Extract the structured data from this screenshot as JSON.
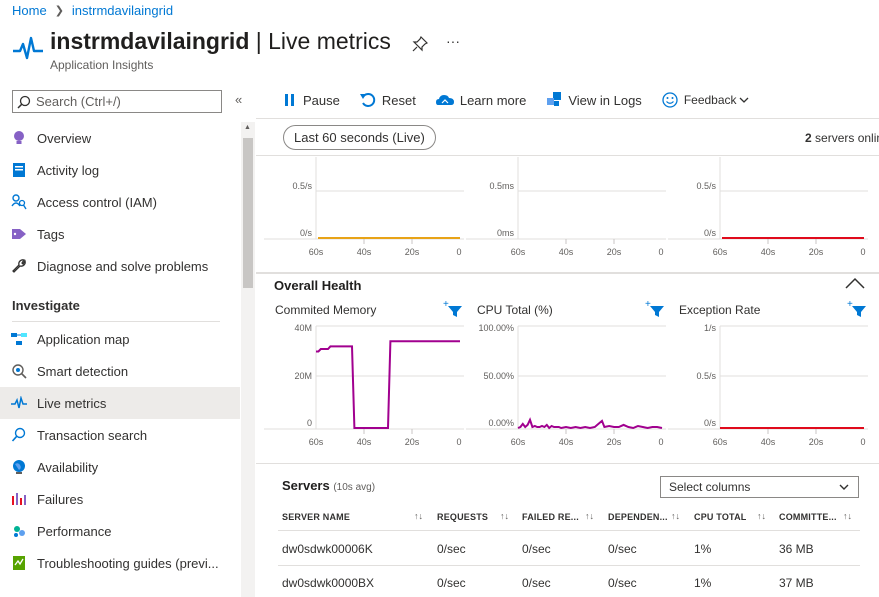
{
  "breadcrumb": {
    "home": "Home",
    "resource": "instrmdavilaingrid"
  },
  "header": {
    "resource_name": "instrmdavilaingrid",
    "separator": " | ",
    "page_name": "Live metrics",
    "subtitle": "Application Insights",
    "pin_icon": "pin-icon",
    "more_label": "···"
  },
  "sidebar": {
    "search_placeholder": "Search (Ctrl+/)",
    "collapse_label": "«",
    "section_investigate": "Investigate",
    "items": [
      {
        "label": "Overview",
        "icon": "lightbulb-icon",
        "color": "#8661c5"
      },
      {
        "label": "Activity log",
        "icon": "activity-log-icon",
        "color": "#0078d4"
      },
      {
        "label": "Access control (IAM)",
        "icon": "people-icon",
        "color": "#0078d4"
      },
      {
        "label": "Tags",
        "icon": "tag-icon",
        "color": "#8661c5"
      },
      {
        "label": "Diagnose and solve problems",
        "icon": "wrench-icon",
        "color": "#323130"
      },
      {
        "label": "Application map",
        "icon": "app-map-icon",
        "color": "#0078d4"
      },
      {
        "label": "Smart detection",
        "icon": "smart-detection-icon",
        "color": "#605e5c"
      },
      {
        "label": "Live metrics",
        "icon": "pulse-icon",
        "color": "#0078d4"
      },
      {
        "label": "Transaction search",
        "icon": "search-icon",
        "color": "#0078d4"
      },
      {
        "label": "Availability",
        "icon": "globe-icon",
        "color": "#0078d4"
      },
      {
        "label": "Failures",
        "icon": "bar-chart-icon",
        "color": "#e81123"
      },
      {
        "label": "Performance",
        "icon": "performance-icon",
        "color": "#00b294"
      },
      {
        "label": "Troubleshooting guides (previ...",
        "icon": "guide-icon",
        "color": "#57a300"
      }
    ],
    "active_item": "Live metrics"
  },
  "toolbar": {
    "pause": "Pause",
    "reset": "Reset",
    "learn_more": "Learn more",
    "view_in_logs": "View in Logs",
    "feedback": "Feedback"
  },
  "time_range": "Last 60 seconds (Live)",
  "servers_online": {
    "count": "2",
    "label": "servers online"
  },
  "top_charts": [
    {
      "y_labels": [
        "0.5/s",
        "0/s"
      ],
      "x_labels": [
        "60s",
        "40s",
        "20s",
        "0"
      ],
      "line_color": "#e8a317"
    },
    {
      "y_labels": [
        "0.5ms",
        "0ms"
      ],
      "x_labels": [
        "60s",
        "40s",
        "20s",
        "0"
      ],
      "line_color": ""
    },
    {
      "y_labels": [
        "0.5/s",
        "0/s"
      ],
      "x_labels": [
        "60s",
        "40s",
        "20s",
        "0"
      ],
      "line_color": "#e00b1c"
    }
  ],
  "overall_health": {
    "title": "Overall Health",
    "charts": [
      {
        "title": "Commited Memory",
        "y_labels": [
          "40M",
          "20M",
          "0"
        ],
        "x_labels": [
          "60s",
          "40s",
          "20s",
          "0"
        ],
        "line_color": "#a1008f",
        "ymax": 40,
        "points": [
          [
            60,
            30
          ],
          [
            59,
            30
          ],
          [
            58,
            31
          ],
          [
            55,
            31
          ],
          [
            54,
            32
          ],
          [
            46,
            32
          ],
          [
            45,
            32
          ],
          [
            44,
            0
          ],
          [
            41,
            0
          ],
          [
            30,
            0
          ],
          [
            29,
            34
          ],
          [
            0,
            34
          ]
        ]
      },
      {
        "title": "CPU Total (%)",
        "y_labels": [
          "100.00%",
          "50.00%",
          "0.00%"
        ],
        "x_labels": [
          "60s",
          "40s",
          "20s",
          "0"
        ],
        "line_color": "#a1008f",
        "ymax": 100,
        "points": [
          [
            60,
            0
          ],
          [
            59,
            1
          ],
          [
            58,
            4
          ],
          [
            57,
            1
          ],
          [
            56,
            3
          ],
          [
            55,
            8
          ],
          [
            54,
            1
          ],
          [
            53,
            2
          ],
          [
            52,
            1
          ],
          [
            51,
            1
          ],
          [
            50,
            2
          ],
          [
            49,
            1
          ],
          [
            48,
            3
          ],
          [
            47,
            0
          ],
          [
            46,
            2
          ],
          [
            45,
            1
          ],
          [
            44,
            1
          ],
          [
            43,
            1
          ],
          [
            42,
            0
          ],
          [
            40,
            1
          ],
          [
            38,
            0
          ],
          [
            36,
            1
          ],
          [
            34,
            0
          ],
          [
            32,
            1
          ],
          [
            30,
            0
          ],
          [
            28,
            1
          ],
          [
            26,
            5
          ],
          [
            25,
            7
          ],
          [
            24,
            1
          ],
          [
            22,
            2
          ],
          [
            20,
            1
          ],
          [
            18,
            1
          ],
          [
            16,
            3
          ],
          [
            14,
            1
          ],
          [
            12,
            0
          ],
          [
            10,
            2
          ],
          [
            8,
            1
          ],
          [
            6,
            0
          ],
          [
            4,
            1
          ],
          [
            2,
            1
          ],
          [
            0,
            0
          ]
        ]
      },
      {
        "title": "Exception Rate",
        "y_labels": [
          "1/s",
          "0.5/s",
          "0/s"
        ],
        "x_labels": [
          "60s",
          "40s",
          "20s",
          "0"
        ],
        "line_color": "#e00b1c",
        "ymax": 1,
        "points": [
          [
            60,
            0
          ],
          [
            0,
            0
          ]
        ]
      }
    ]
  },
  "servers": {
    "title": "Servers",
    "subtitle": "(10s avg)",
    "select_columns": "Select columns",
    "columns": [
      "SERVER NAME",
      "REQUESTS",
      "FAILED RE...",
      "DEPENDEN...",
      "CPU TOTAL",
      "COMMITTE..."
    ],
    "rows": [
      [
        "dw0sdwk00006K",
        "0/sec",
        "0/sec",
        "0/sec",
        "1%",
        "36 MB"
      ],
      [
        "dw0sdwk0000BX",
        "0/sec",
        "0/sec",
        "0/sec",
        "1%",
        "37 MB"
      ]
    ]
  }
}
